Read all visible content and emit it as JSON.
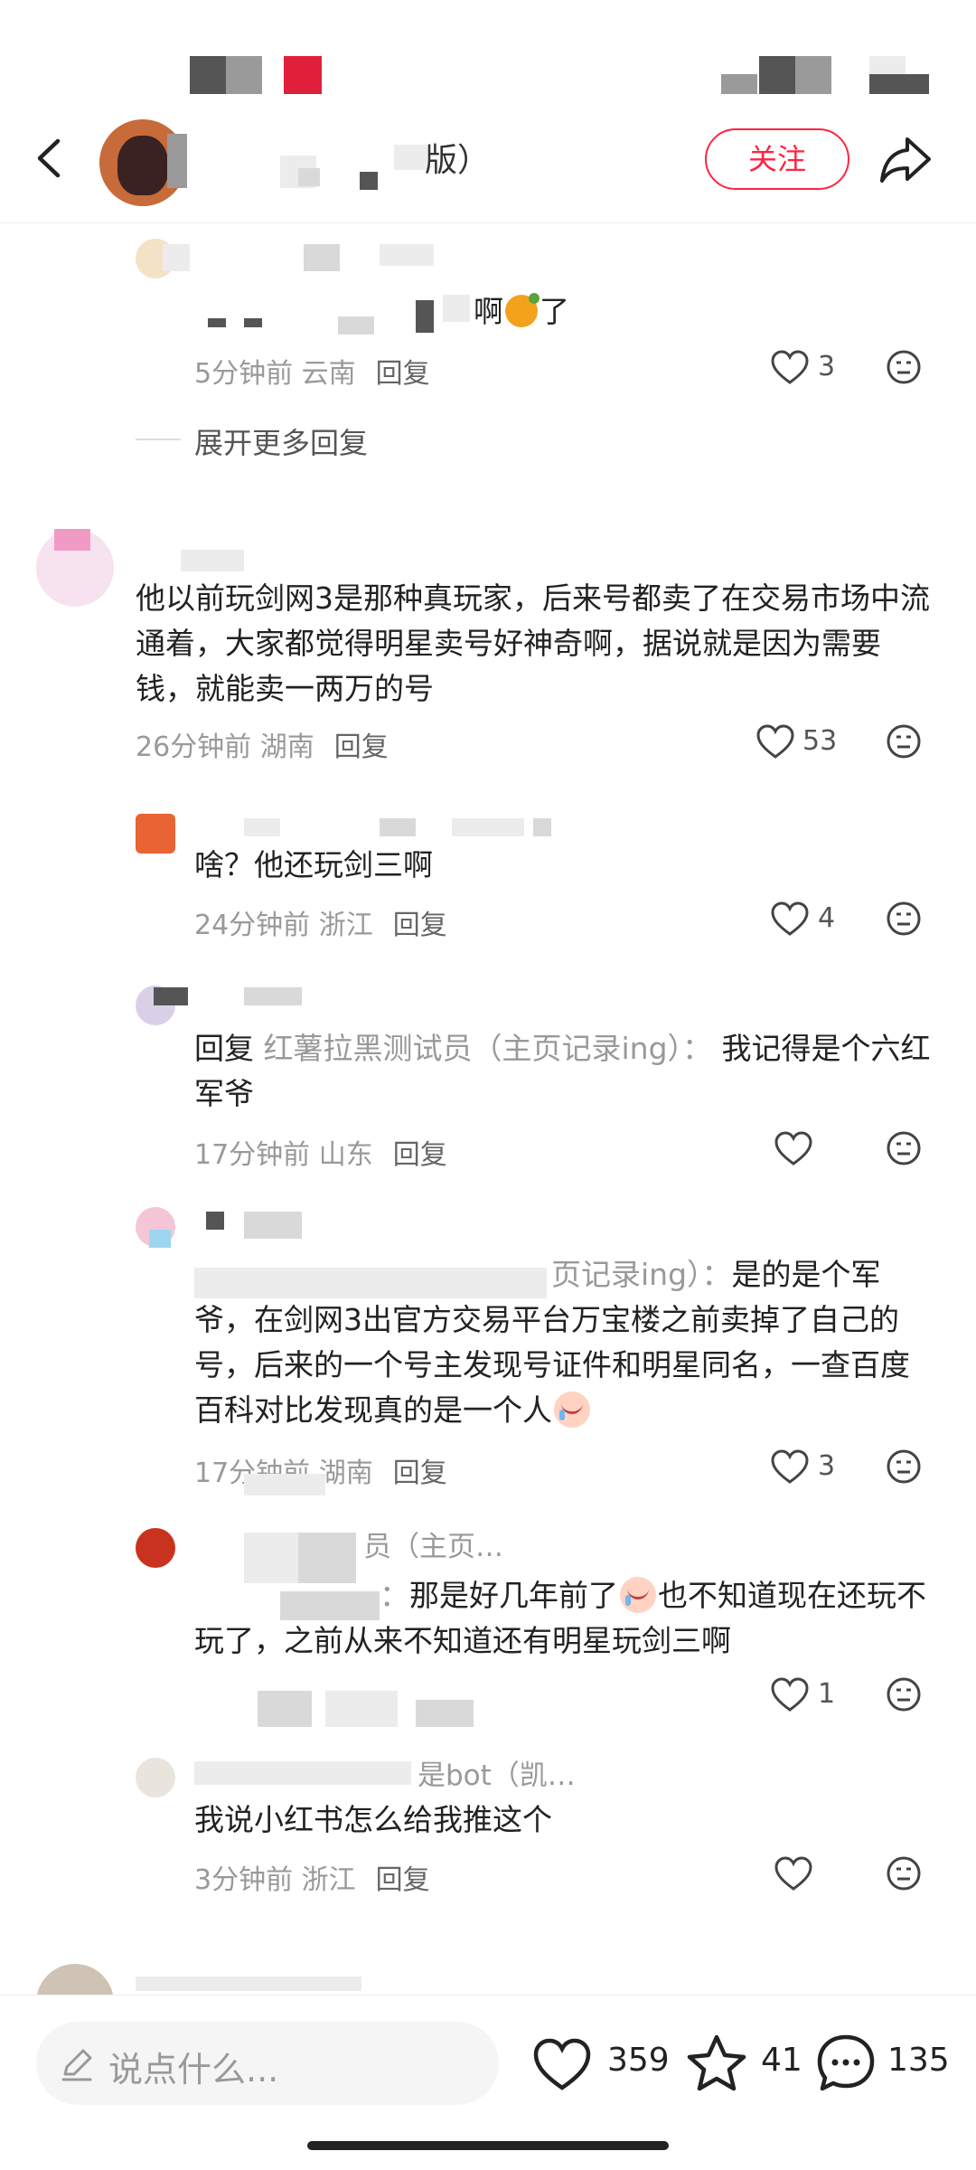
{
  "header": {
    "title_fragment": "版）",
    "follow_label": "关注"
  },
  "comments": [
    {
      "text": "啊",
      "text_suffix": "了",
      "time": "5分钟前",
      "location": "云南",
      "reply_label": "回复",
      "likes": "3"
    },
    {
      "expand_label": "展开更多回复"
    },
    {
      "text": "他以前玩剑网3是那种真玩家，后来号都卖了在交易市场中流通着，大家都觉得明星卖号好神奇啊，据说就是因为需要钱，就能卖一两万的号",
      "time": "26分钟前",
      "location": "湖南",
      "reply_label": "回复",
      "likes": "53"
    },
    {
      "text": "啥？他还玩剑三啊",
      "time": "24分钟前",
      "location": "浙江",
      "reply_label": "回复",
      "likes": "4"
    },
    {
      "reply_prefix": "回复",
      "quoted": "红薯拉黑测试员（主页记录ing）：",
      "text": "我记得是个六红军爷",
      "time": "17分钟前",
      "location": "山东",
      "reply_label": "回复",
      "likes": ""
    },
    {
      "quoted": "页记录ing）：",
      "text": "是的是个军爷，在剑网3出官方交易平台万宝楼之前卖掉了自己的号，后来的一个号主发现号证件和明星同名，一查百度百科对比发现真的是一个人",
      "time": "17分钟前",
      "location": "湖南",
      "reply_label": "回复",
      "likes": "3"
    },
    {
      "name_fragment": "员（主页…",
      "quoted": "：",
      "text": "那是好几年前了",
      "text_suffix": "也不知道现在还玩不玩了，之前从来不知道还有明星玩剑三啊",
      "likes": "1"
    },
    {
      "name_fragment": "是bot（凯…",
      "text": "我说小红书怎么给我推这个",
      "time": "3分钟前",
      "location": "浙江",
      "reply_label": "回复",
      "likes": ""
    }
  ],
  "bottom_bar": {
    "placeholder": "说点什么...",
    "likes": "359",
    "favorites": "41",
    "comments": "135"
  },
  "icons": {
    "back": "chevron-left-icon",
    "share": "share-arrow-icon",
    "like": "heart-outline-icon",
    "dislike": "neutral-face-icon",
    "favorite": "star-outline-icon",
    "comment": "speech-bubble-icon",
    "edit": "pencil-icon"
  },
  "colors": {
    "accent": "#ff2442",
    "meta_text": "#999999"
  }
}
